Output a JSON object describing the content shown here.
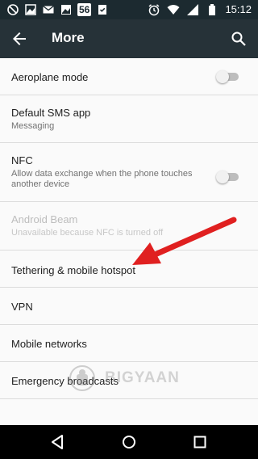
{
  "status_bar": {
    "time": "15:12",
    "badge": "56"
  },
  "toolbar": {
    "title": "More"
  },
  "items": [
    {
      "title": "Aeroplane mode",
      "toggle": "off"
    },
    {
      "title": "Default SMS app",
      "subtitle": "Messaging"
    },
    {
      "title": "NFC",
      "subtitle": "Allow data exchange when the phone touches another device",
      "toggle": "off"
    },
    {
      "title": "Android Beam",
      "subtitle": "Unavailable because NFC is turned off",
      "disabled": true
    },
    {
      "title": "Tethering & mobile hotspot"
    },
    {
      "title": "VPN"
    },
    {
      "title": "Mobile networks"
    },
    {
      "title": "Emergency broadcasts"
    }
  ],
  "watermark": {
    "text": "BIGYAAN"
  },
  "colors": {
    "toolbar": "#263238",
    "status_bar": "#1c2a30",
    "arrow": "#e02020"
  }
}
